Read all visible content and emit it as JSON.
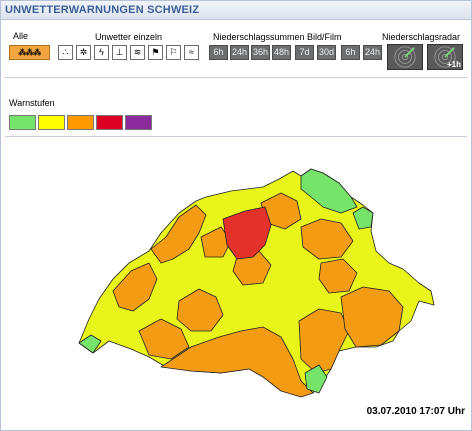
{
  "window": {
    "title": "UNWETTERWARNUNGEN SCHWEIZ"
  },
  "toolbar": {
    "alle_label": "Alle",
    "einzeln_label": "Unwetter einzeln",
    "niederschlag_label": "Niederschlagssummen Bild/Film",
    "radar_label": "Niederschlagsradar",
    "alle_icon": "all-hazards-icon",
    "single_icons": [
      "rain-icon",
      "snow-icon",
      "thunderstorm-icon",
      "frost-icon",
      "slippery-road-icon",
      "wind-icon",
      "forest-fire-icon",
      "flood-icon"
    ],
    "durations": [
      "6h",
      "24h",
      "36h",
      "48h",
      "7d",
      "30d",
      "6h",
      "24h"
    ],
    "radar_plus_label": "+1h"
  },
  "warnstufen": {
    "label": "Warnstufen",
    "colors": [
      "#76e36a",
      "#ffff00",
      "#ff9900",
      "#dd0022",
      "#8b2a9a"
    ]
  },
  "map": {
    "colors": {
      "green": "#76e36a",
      "yellow": "#e9f518",
      "orange": "#f29b13",
      "red": "#e3312c",
      "border": "#222222"
    }
  },
  "timestamp": "03.07.2010 17:07 Uhr"
}
